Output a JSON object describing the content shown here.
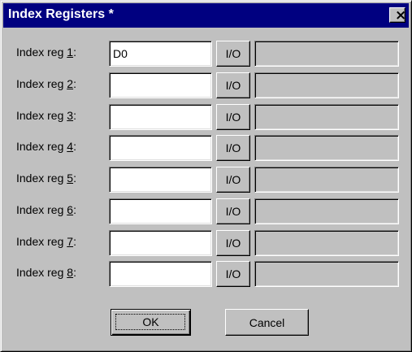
{
  "window": {
    "title": "Index Registers *",
    "close_glyph": "×"
  },
  "registers": [
    {
      "label_prefix": "Index reg ",
      "mnemonic": "1",
      "label_suffix": ":",
      "value": "D0",
      "io_label": "I/O",
      "io_value": ""
    },
    {
      "label_prefix": "Index reg ",
      "mnemonic": "2",
      "label_suffix": ":",
      "value": "",
      "io_label": "I/O",
      "io_value": ""
    },
    {
      "label_prefix": "Index reg ",
      "mnemonic": "3",
      "label_suffix": ":",
      "value": "",
      "io_label": "I/O",
      "io_value": ""
    },
    {
      "label_prefix": "Index reg ",
      "mnemonic": "4",
      "label_suffix": ":",
      "value": "",
      "io_label": "I/O",
      "io_value": ""
    },
    {
      "label_prefix": "Index reg ",
      "mnemonic": "5",
      "label_suffix": ":",
      "value": "",
      "io_label": "I/O",
      "io_value": ""
    },
    {
      "label_prefix": "Index reg ",
      "mnemonic": "6",
      "label_suffix": ":",
      "value": "",
      "io_label": "I/O",
      "io_value": ""
    },
    {
      "label_prefix": "Index reg ",
      "mnemonic": "7",
      "label_suffix": ":",
      "value": "",
      "io_label": "I/O",
      "io_value": ""
    },
    {
      "label_prefix": "Index reg ",
      "mnemonic": "8",
      "label_suffix": ":",
      "value": "",
      "io_label": "I/O",
      "io_value": ""
    }
  ],
  "buttons": {
    "ok_label": "OK",
    "cancel_label": "Cancel"
  },
  "colors": {
    "titlebar": "#000080",
    "face": "#c0c0c0"
  }
}
